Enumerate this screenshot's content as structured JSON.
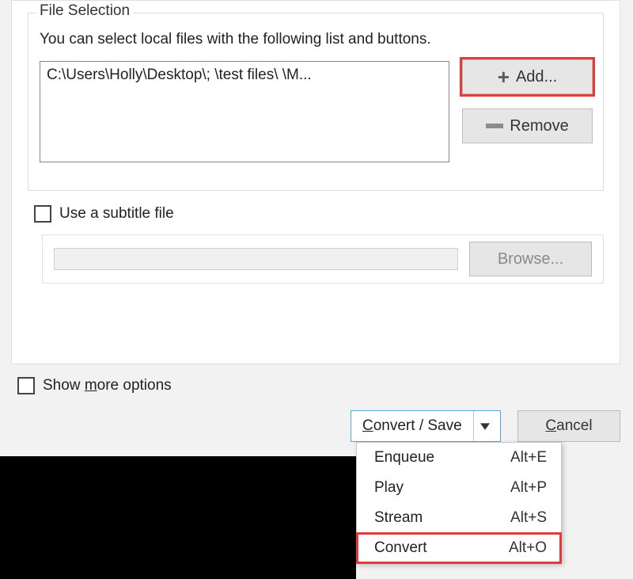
{
  "file_selection": {
    "legend": "File Selection",
    "description": "You can select local files with the following list and buttons.",
    "list_entry": "C:\\Users\\Holly\\Desktop\\;     \\test files\\       \\M...",
    "add_label": "Add...",
    "remove_label": "Remove"
  },
  "subtitle": {
    "checkbox_label": "Use a subtitle file",
    "browse_label": "Browse..."
  },
  "options": {
    "show_more_prefix": "Show ",
    "show_more_char": "m",
    "show_more_suffix": "ore options"
  },
  "buttons": {
    "convert_prefix": "",
    "convert_char": "C",
    "convert_suffix": "onvert / Save",
    "cancel_prefix": "",
    "cancel_char": "C",
    "cancel_suffix": "ancel"
  },
  "menu": [
    {
      "label": "Enqueue",
      "shortcut": "Alt+E",
      "highlight": false
    },
    {
      "label": "Play",
      "shortcut": "Alt+P",
      "highlight": false
    },
    {
      "label": "Stream",
      "shortcut": "Alt+S",
      "highlight": false
    },
    {
      "label": "Convert",
      "shortcut": "Alt+O",
      "highlight": true
    }
  ]
}
